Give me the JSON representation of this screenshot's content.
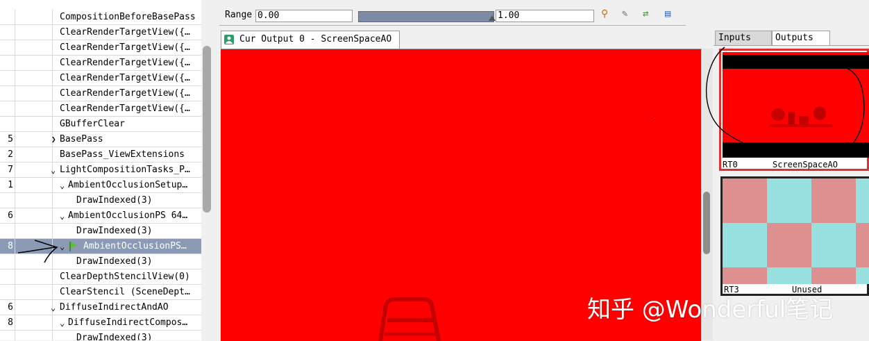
{
  "event_tree": {
    "rows": [
      {
        "eid": "",
        "label": "CompositionBeforeBasePass"
      },
      {
        "eid": "",
        "label": "ClearRenderTargetView({…"
      },
      {
        "eid": "",
        "label": "ClearRenderTargetView({…"
      },
      {
        "eid": "",
        "label": "ClearRenderTargetView({…"
      },
      {
        "eid": "",
        "label": "ClearRenderTargetView({…"
      },
      {
        "eid": "",
        "label": "ClearRenderTargetView({…"
      },
      {
        "eid": "",
        "label": "ClearRenderTargetView({…"
      },
      {
        "eid": "",
        "label": "GBufferClear"
      },
      {
        "eid": "5",
        "label": "BasePass"
      },
      {
        "eid": "2",
        "label": "BasePass_ViewExtensions"
      },
      {
        "eid": "7",
        "label": "LightCompositionTasks_P…"
      },
      {
        "eid": "1",
        "label": "AmbientOcclusionSetup…"
      },
      {
        "eid": "",
        "label": "DrawIndexed(3)"
      },
      {
        "eid": "6",
        "label": "AmbientOcclusionPS 64…"
      },
      {
        "eid": "",
        "label": "DrawIndexed(3)"
      },
      {
        "eid": "8",
        "label": "AmbientOcclusionPS…"
      },
      {
        "eid": "",
        "label": "DrawIndexed(3)"
      },
      {
        "eid": "",
        "label": "ClearDepthStencilView(0)"
      },
      {
        "eid": "",
        "label": "ClearStencil (SceneDept…"
      },
      {
        "eid": "6",
        "label": "DiffuseIndirectAndAO"
      },
      {
        "eid": "8",
        "label": "DiffuseIndirectCompos…"
      },
      {
        "eid": "",
        "label": "DrawIndexed(3)"
      }
    ]
  },
  "toolbar": {
    "range_label": "Range",
    "range_min": "0.00",
    "range_max": "1.00"
  },
  "texture_tab": {
    "label": "Cur Output 0 - ScreenSpaceAO"
  },
  "right_panel": {
    "tabs": [
      "Inputs",
      "Outputs"
    ],
    "active_tab": "Outputs",
    "thumbnails": [
      {
        "slot": "RT0",
        "name": "ScreenSpaceAO"
      },
      {
        "slot": "RT3",
        "name": "Unused"
      }
    ]
  },
  "watermark": "知乎 @Wonderful笔记",
  "colors": {
    "output_red": "#ff0000",
    "selection": "#8c9bb5",
    "checker_pink": "#de9090",
    "checker_cyan": "#98e0e0"
  },
  "icons": [
    "expand-chevron-icon",
    "collapse-chevron-icon",
    "green-flag-icon",
    "texture-tab-icon",
    "toolbar-tool-icons"
  ]
}
